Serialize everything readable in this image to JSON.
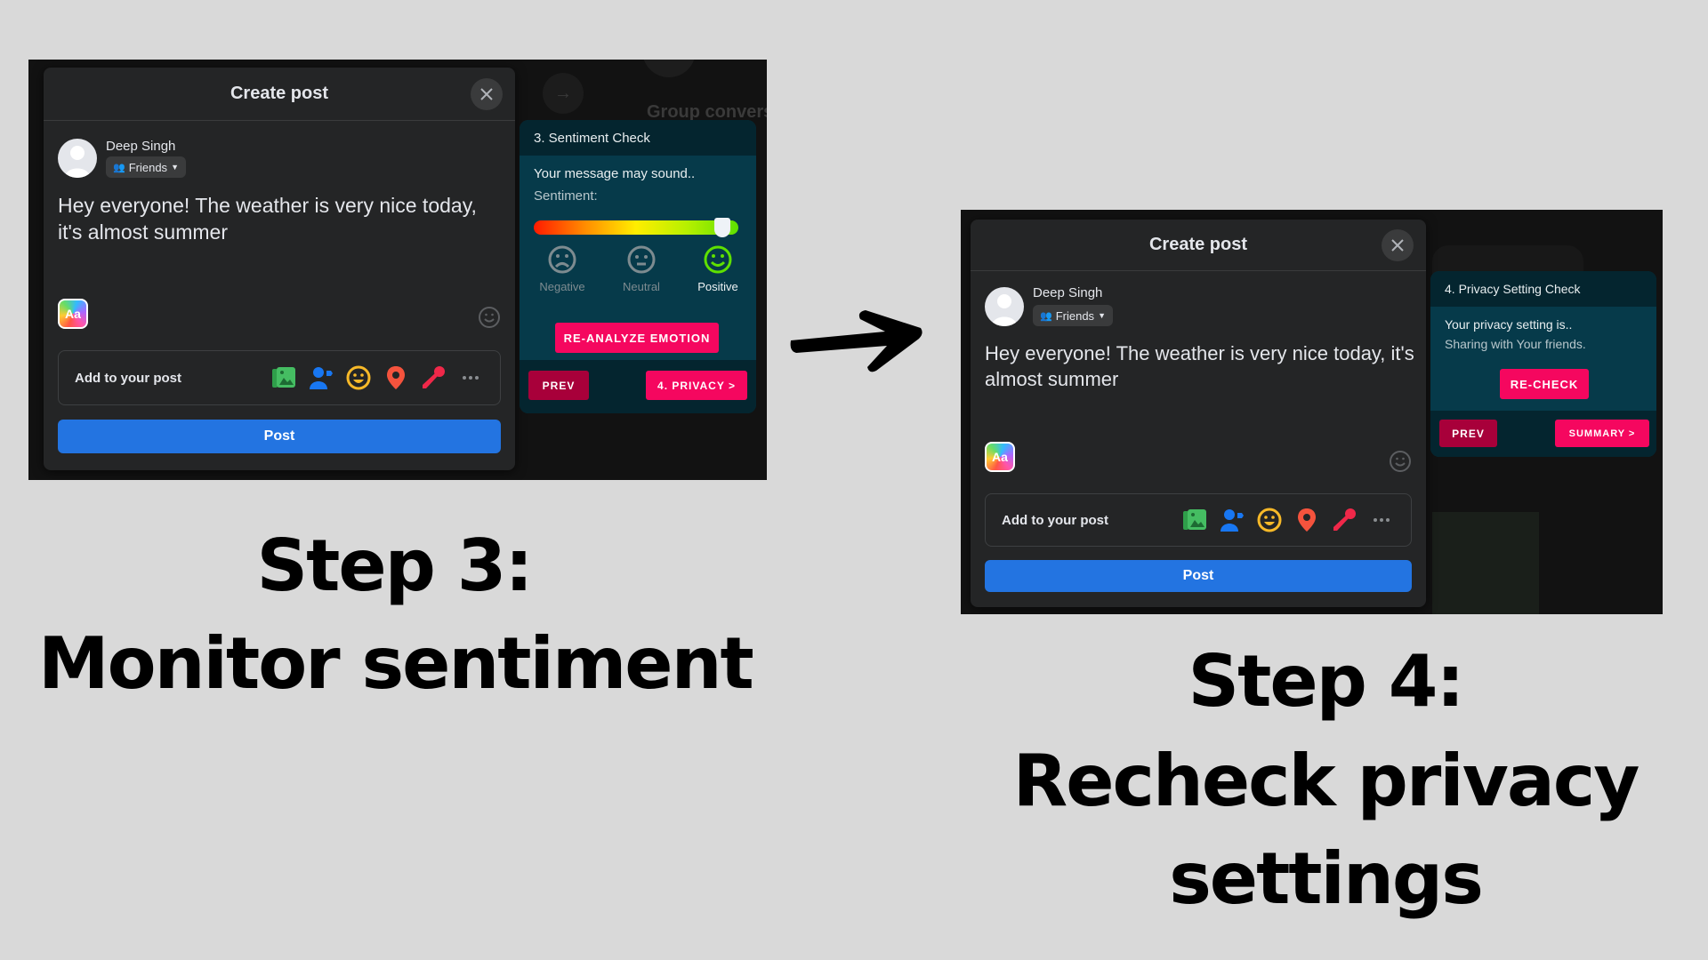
{
  "steps": [
    {
      "caption_line1": "Step 3:",
      "caption_line2": "Monitor sentiment",
      "modal": {
        "title": "Create post",
        "user_name": "Deep Singh",
        "audience": "Friends",
        "post_text": "Hey everyone! The weather is very nice today, it's almost summer",
        "aa_label": "Aa",
        "add_to_post_label": "Add to your post",
        "post_button": "Post",
        "add_icons": [
          "photo-video-icon",
          "tag-people-icon",
          "feeling-icon",
          "check-in-icon",
          "live-video-icon",
          "more-icon"
        ]
      },
      "background": {
        "side_text": "Group conversa"
      },
      "panel": {
        "title": "3. Sentiment Check",
        "line1": "Your message may sound..",
        "line2": "Sentiment:",
        "sentiment_value": 0.92,
        "options": [
          {
            "label": "Negative",
            "selected": false
          },
          {
            "label": "Neutral",
            "selected": false
          },
          {
            "label": "Positive",
            "selected": true
          }
        ],
        "action_button": "RE-ANALYZE EMOTION",
        "prev_button": "PREV",
        "next_button": "4. PRIVACY >"
      }
    },
    {
      "caption_line1": "Step 4:",
      "caption_line2": "Recheck privacy",
      "caption_line3": "settings",
      "modal": {
        "title": "Create post",
        "user_name": "Deep Singh",
        "audience": "Friends",
        "post_text": "Hey everyone! The weather is very nice today, it's almost summer",
        "aa_label": "Aa",
        "add_to_post_label": "Add to your post",
        "post_button": "Post",
        "add_icons": [
          "photo-video-icon",
          "tag-people-icon",
          "feeling-icon",
          "check-in-icon",
          "live-video-icon",
          "more-icon"
        ]
      },
      "panel": {
        "title": "4. Privacy Setting Check",
        "line1": "Your privacy setting is..",
        "line2": "Sharing with Your friends.",
        "action_button": "RE-CHECK",
        "prev_button": "PREV",
        "next_button": "SUMMARY >"
      }
    }
  ],
  "colors": {
    "post_blue": "#2374e1",
    "accent_pink": "#f5075f",
    "prev_crimson": "#a8003a",
    "panel_teal": "#063a4a",
    "positive_green": "#5ee000"
  }
}
